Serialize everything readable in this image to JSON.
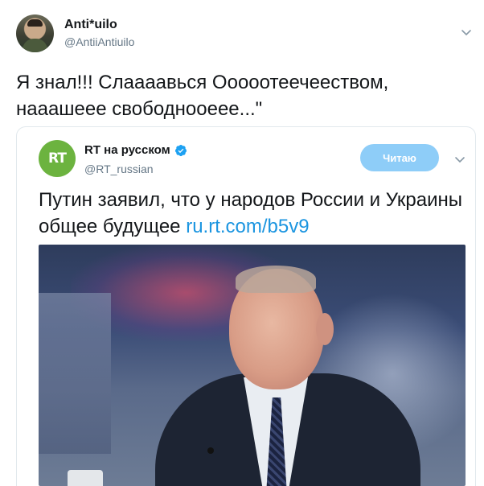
{
  "tweet": {
    "display_name": "Anti*uilo",
    "handle": "@AntiiAntiuilo",
    "text": "Я знал!!! Слаааавься Ооооотеечееством, нааашеее свободнооеее...\"",
    "menu_icon": "chevron-down-icon"
  },
  "quoted": {
    "logo_text": "RT",
    "display_name": "RT на русском",
    "verified_icon": "verified-badge-icon",
    "handle": "@RT_russian",
    "follow_label": "Читаю",
    "text": "Путин заявил, что у народов России и Украины общее будущее ",
    "link": "ru.rt.com/b5v9",
    "menu_icon": "chevron-down-icon"
  },
  "colors": {
    "link": "#1b95e0",
    "follow_button": "#8ecdf8",
    "rt_green": "#6cb33f",
    "secondary_text": "#657786"
  }
}
